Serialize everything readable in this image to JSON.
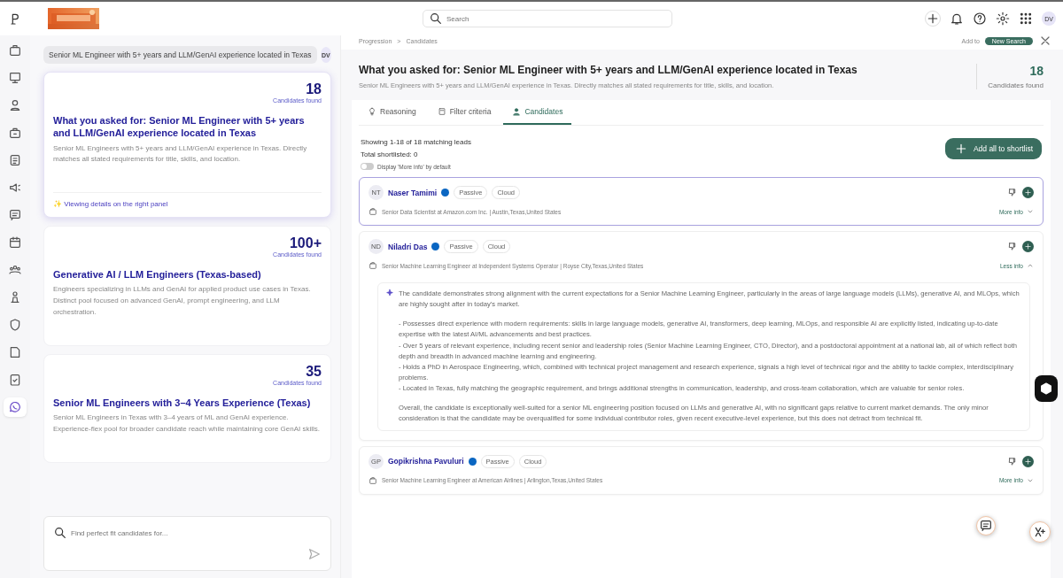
{
  "header": {
    "search": {
      "placeholder": "Search"
    },
    "avatar": "DV"
  },
  "sidebar": {
    "items": [
      {
        "selected": false
      },
      {
        "selected": false
      },
      {
        "selected": false
      },
      {
        "selected": false
      },
      {
        "selected": false
      },
      {
        "selected": false
      },
      {
        "selected": false
      },
      {
        "selected": false
      },
      {
        "selected": false
      },
      {
        "selected": false
      },
      {
        "selected": false
      },
      {
        "selected": false
      },
      {
        "selected": false
      },
      {
        "selected": true
      }
    ]
  },
  "chat": {
    "query": "Senior ML Engineer with 5+ years and LLM/GenAI experience located in Texas",
    "user_initials": "DV",
    "results": [
      {
        "count": "18",
        "count_label": "Candidates found",
        "title": "What you asked for: Senior ML Engineer with 5+ years and LLM/GenAI experience located in Texas",
        "description": "Senior ML Engineers with 5+ years and LLM/GenAI experience in Texas. Directly matches all stated requirements for title, skills, and location.",
        "selected": true,
        "note": "✨ Viewing details on the right panel"
      },
      {
        "count": "100+",
        "count_label": "Candidates found",
        "title": "Generative AI / LLM Engineers (Texas-based)",
        "description": "Engineers specializing in LLMs and GenAI for applied product use cases in Texas. Distinct pool focused on advanced GenAI, prompt engineering, and LLM orchestration.",
        "selected": false
      },
      {
        "count": "35",
        "count_label": "Candidates found",
        "title": "Senior ML Engineers with 3–4 Years Experience (Texas)",
        "description": "Senior ML Engineers in Texas with 3–4 years of ML and GenAI experience. Experience-flex pool for broader candidate reach while maintaining core GenAI skills.",
        "selected": false
      }
    ],
    "input": {
      "placeholder": "Find perfect fit candidates for..."
    }
  },
  "detail": {
    "breadcrumb": [
      "Progression",
      "Candidates"
    ],
    "breadcrumb_separator": ">",
    "add_to": "Add to",
    "new_search": "New Search",
    "title": "What you asked for: Senior ML Engineer with 5+ years and LLM/GenAI experience located in Texas",
    "subtitle": "Senior ML Engineers with 5+ years and LLM/GenAI experience in Texas. Directly matches all stated requirements for title, skills, and location.",
    "count": "18",
    "count_label": "Candidates found",
    "tabs": [
      {
        "label": "Reasoning",
        "selected": false
      },
      {
        "label": "Filter criteria",
        "selected": false
      },
      {
        "label": "Candidates",
        "selected": true
      }
    ],
    "showing": "Showing 1-18 of 18 matching leads",
    "shortlisted": "Total shortlisted: 0",
    "toggle": {
      "label": "Display 'More info' by default",
      "on": false
    },
    "add_all": "Add all to shortlist",
    "candidates": [
      {
        "initials": "NT",
        "name": "Naser Tamimi",
        "tags": [
          "Passive",
          "Cloud"
        ],
        "headline": "Senior Data Scientist at Amazon.com Inc. | Austin,Texas,United States",
        "info_label": "More info",
        "expanded": false,
        "selected": true
      },
      {
        "initials": "ND",
        "name": "Niladri Das",
        "tags": [
          "Passive",
          "Cloud"
        ],
        "headline": "Senior Machine Learning Engineer at Independent Systems Operator | Royse City,Texas,United States",
        "info_label": "Less info",
        "expanded": true,
        "selected": false,
        "reasoning": [
          "The candidate demonstrates strong alignment with the current expectations for a Senior Machine Learning Engineer, particularly in the areas of large language models (LLMs), generative AI, and MLOps, which are highly sought after in today's market.",
          "- Possesses direct experience with modern requirements: skills in large language models, generative AI, transformers, deep learning, MLOps, and responsible AI are explicitly listed, indicating up-to-date expertise with the latest AI/ML advancements and best practices.",
          "- Over 5 years of relevant experience, including recent senior and leadership roles (Senior Machine Learning Engineer, CTO, Director), and a postdoctoral appointment at a national lab, all of which reflect both depth and breadth in advanced machine learning and engineering.",
          "- Holds a PhD in Aerospace Engineering, which, combined with technical project management and research experience, signals a high level of technical rigor and the ability to tackle complex, interdisciplinary problems.",
          "- Located in Texas, fully matching the geographic requirement, and brings additional strengths in communication, leadership, and cross-team collaboration, which are valuable for senior roles.",
          "Overall, the candidate is exceptionally well-suited for a senior ML engineering position focused on LLMs and generative AI, with no significant gaps relative to current market demands. The only minor consideration is that the candidate may be overqualified for some individual contributor roles, given recent executive-level experience, but this does not detract from technical fit."
        ]
      },
      {
        "initials": "GP",
        "name": "Gopikrishna Pavuluri",
        "tags": [
          "Passive",
          "Cloud"
        ],
        "headline": "Senior Machine Learning Engineer at American Airlines | Arlington,Texas,United States",
        "info_label": "More info",
        "expanded": false,
        "selected": false
      }
    ]
  }
}
